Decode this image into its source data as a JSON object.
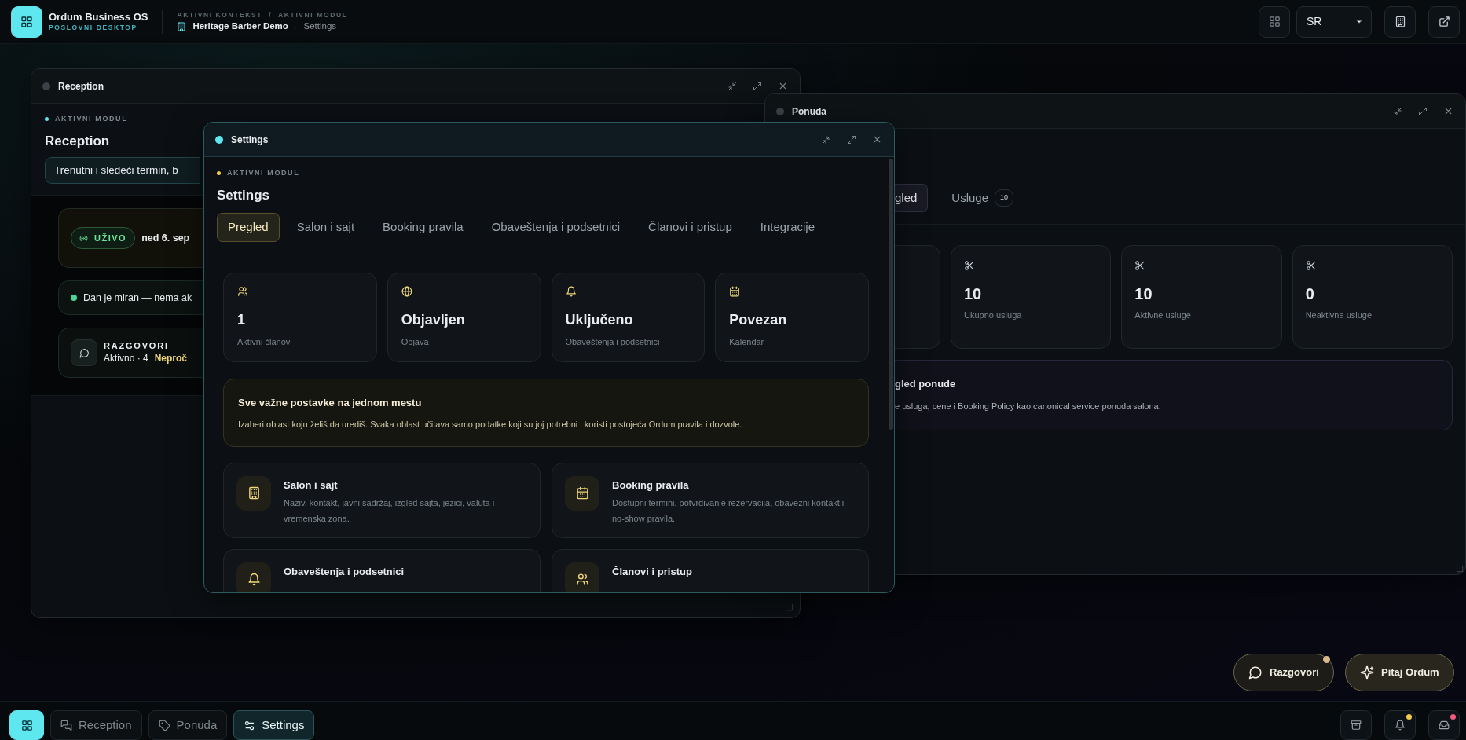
{
  "app": {
    "name": "Ordum Business OS",
    "subtitle": "POSLOVNI DESKTOP"
  },
  "context": {
    "label": "AKTIVNI KONTEKST",
    "separator": "/",
    "module_label": "AKTIVNI MODUL",
    "business": "Heritage Barber Demo",
    "dot": "·",
    "module": "Settings"
  },
  "language": {
    "value": "SR"
  },
  "windows": [
    {
      "kind": "reception",
      "title": "Reception",
      "focused": false,
      "eyebrow": "AKTIVNI MODUL",
      "heading": "Reception",
      "summary": "Trenutni i sledeći termin, b",
      "live_badge": "UŽIVO",
      "date": "ned 6. sep",
      "status": "Dan je miran — nema ak",
      "conversations": {
        "title": "RAZGOVORI",
        "active": "Aktivno · 4",
        "unread": "Neproč"
      }
    },
    {
      "kind": "offer",
      "title": "Ponuda",
      "focused": false,
      "tabs": [
        {
          "label": "gled",
          "selected": true
        },
        {
          "label": "Usluge",
          "count": "10",
          "selected": false
        }
      ],
      "stats": [
        {
          "value": "10",
          "label": "Ukupno usluga"
        },
        {
          "value": "10",
          "label": "Aktivne usluge"
        },
        {
          "value": "0",
          "label": "Neaktivne usluge"
        }
      ],
      "overview": {
        "title": "gled ponude",
        "text": "e usluga, cene i Booking Policy kao canonical service ponuda salona."
      }
    },
    {
      "kind": "settings",
      "title": "Settings",
      "focused": true,
      "eyebrow": "AKTIVNI MODUL",
      "heading": "Settings",
      "tabs": [
        {
          "label": "Pregled",
          "selected": true
        },
        {
          "label": "Salon i sajt",
          "selected": false
        },
        {
          "label": "Booking pravila",
          "selected": false
        },
        {
          "label": "Obaveštenja i podsetnici",
          "selected": false
        },
        {
          "label": "Članovi i pristup",
          "selected": false
        },
        {
          "label": "Integracije",
          "selected": false
        }
      ],
      "stats": [
        {
          "value": "1",
          "label": "Aktivni članovi"
        },
        {
          "value": "Objavljen",
          "label": "Objava"
        },
        {
          "value": "Uključeno",
          "label": "Obaveštenja i podsetnici"
        },
        {
          "value": "Povezan",
          "label": "Kalendar"
        }
      ],
      "info": {
        "title": "Sve važne postavke na jednom mestu",
        "text": "Izaberi oblast koju želiš da urediš. Svaka oblast učitava samo podatke koji su joj potrebni i koristi postojeća Ordum pravila i dozvole."
      },
      "sections": [
        {
          "title": "Salon i sajt",
          "text": "Naziv, kontakt, javni sadržaj, izgled sajta, jezici, valuta i vremenska zona."
        },
        {
          "title": "Booking pravila",
          "text": "Dostupni termini, potvrđivanje rezervacija, obavezni kontakt i no-show pravila."
        },
        {
          "title": "Obaveštenja i podsetnici"
        },
        {
          "title": "Članovi i pristup"
        }
      ]
    }
  ],
  "floating": [
    {
      "label": "Razgovori",
      "unread": true
    },
    {
      "label": "Pitaj Ordum",
      "unread": false
    }
  ],
  "taskbar": {
    "items": [
      {
        "label": "Reception",
        "selected": false
      },
      {
        "label": "Ponuda",
        "selected": false
      },
      {
        "label": "Settings",
        "selected": true
      }
    ],
    "trays": [
      {
        "kind": "archive"
      },
      {
        "kind": "notifications",
        "color": "#f2c94c"
      },
      {
        "kind": "inbox",
        "color": "#f05a7e"
      }
    ]
  }
}
